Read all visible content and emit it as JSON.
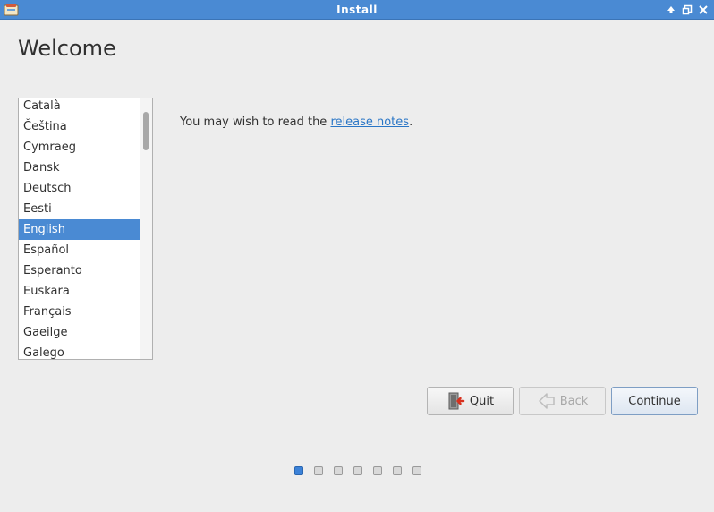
{
  "window": {
    "title": "Install"
  },
  "page": {
    "title": "Welcome"
  },
  "languages": {
    "items": [
      "Català",
      "Čeština",
      "Cymraeg",
      "Dansk",
      "Deutsch",
      "Eesti",
      "English",
      "Español",
      "Esperanto",
      "Euskara",
      "Français",
      "Gaeilge",
      "Galego"
    ],
    "selected": "English"
  },
  "release_notes": {
    "prefix": "You may wish to read the ",
    "link_text": "release notes",
    "suffix": "."
  },
  "buttons": {
    "quit": "Quit",
    "back": "Back",
    "continue": "Continue"
  },
  "progress": {
    "current_step": 1,
    "total_steps": 7
  },
  "colors": {
    "titlebar": "#4a8ad3",
    "selection": "#4a8ad3",
    "link": "#2a76c6",
    "active_step": "#3c82d8"
  }
}
